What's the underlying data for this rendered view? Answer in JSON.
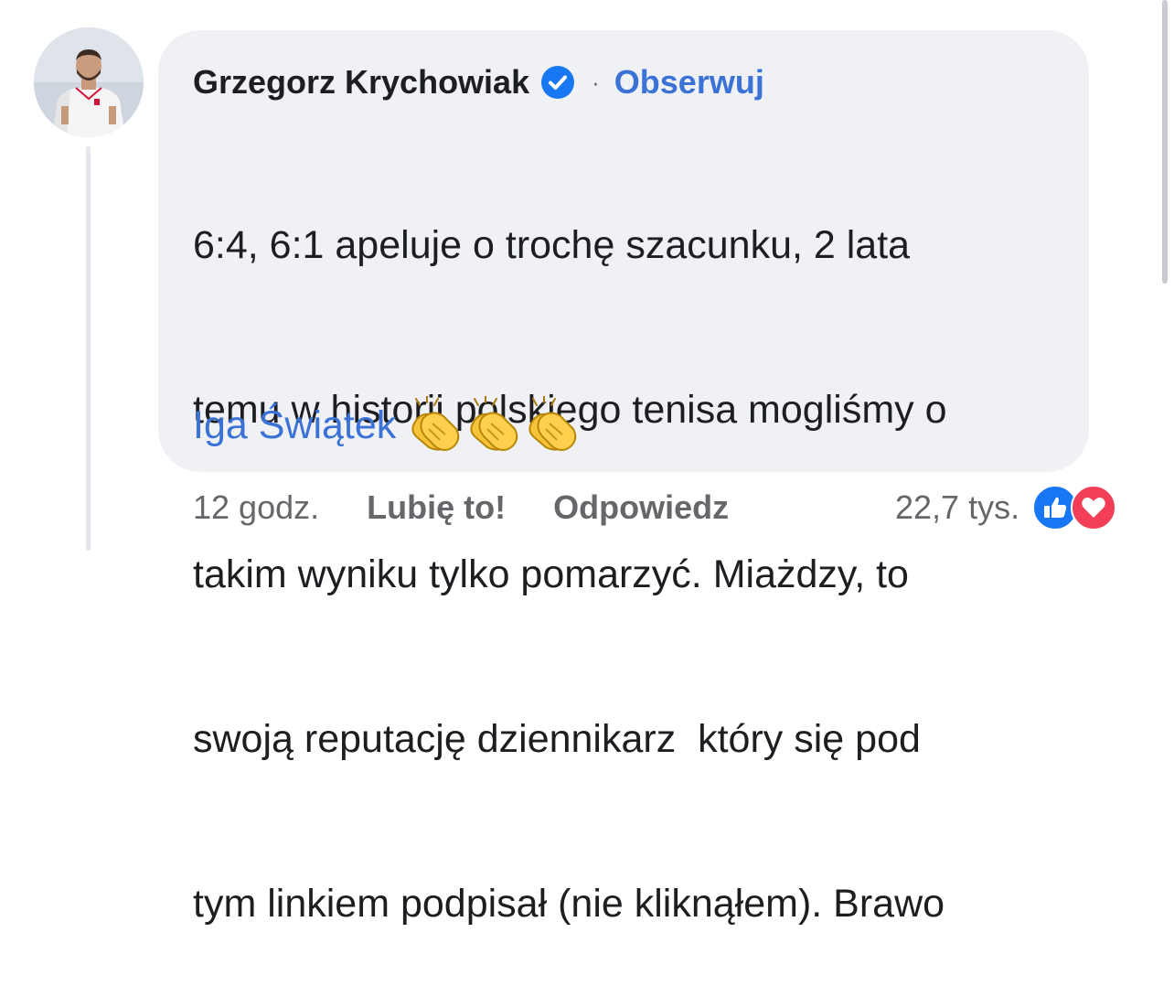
{
  "comment": {
    "author": "Grzegorz Krychowiak",
    "follow_label": "Obserwuj",
    "separator": "·",
    "text_lines": [
      "6:4, 6:1 apeluje o trochę szacunku, 2 lata",
      "temu w historii polskiego tenisa mogliśmy o",
      "takim wyniku tylko pomarzyć. Miażdzy, to",
      "swoją reputację dziennikarz  który się pod",
      "tym linkiem podpisał (nie kliknąłem). Brawo"
    ],
    "mention": "Iga Świątek",
    "emoji": [
      "clapping-hands",
      "clapping-hands",
      "clapping-hands"
    ]
  },
  "actions": {
    "time": "12 godz.",
    "like_label": "Lubię to!",
    "reply_label": "Odpowiedz"
  },
  "reactions": {
    "count": "22,7 tys.",
    "icons": [
      "like-icon",
      "love-icon"
    ]
  },
  "colors": {
    "bubble": "#eff1f5",
    "link": "#3a72d6",
    "meta": "#65676b",
    "like": "#1877f2",
    "love": "#f33e58"
  }
}
